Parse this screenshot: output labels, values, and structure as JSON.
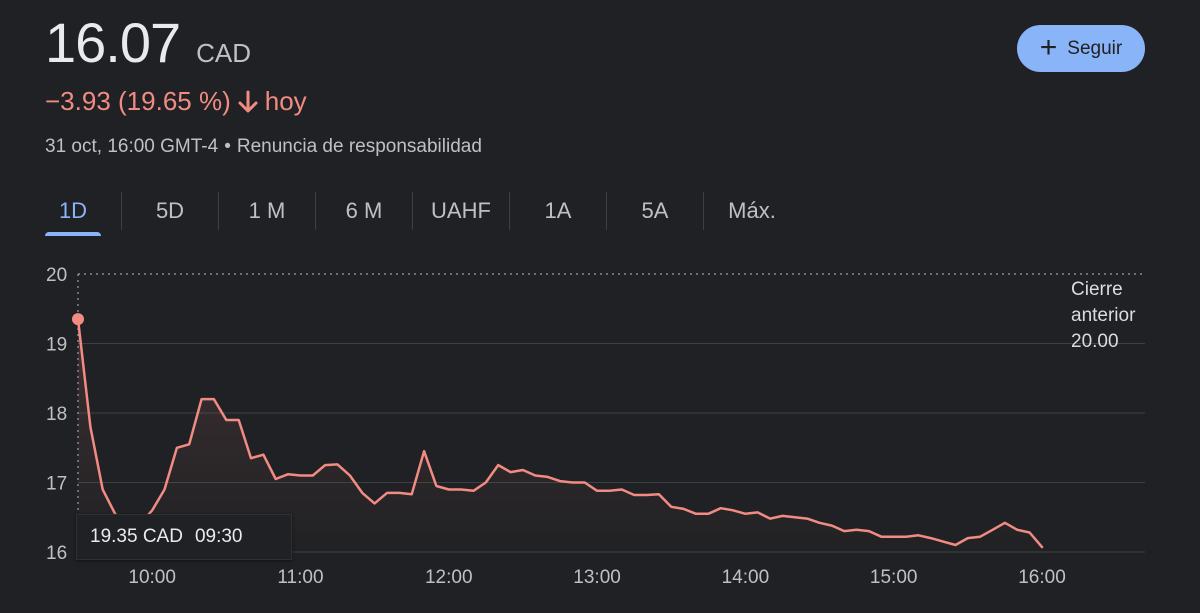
{
  "quote": {
    "price": "16.07",
    "currency": "CAD",
    "change": "−3.93 (19.65 %)",
    "period": "hoy",
    "timestamp": "31 oct, 16:00 GMT-4",
    "separator": "•",
    "disclaimer": "Renuncia de responsabilidad"
  },
  "follow_button": {
    "label": "Seguir",
    "icon": "plus-icon"
  },
  "tabs": [
    {
      "label": "1D",
      "active": true
    },
    {
      "label": "5D",
      "active": false
    },
    {
      "label": "1 M",
      "active": false
    },
    {
      "label": "6 M",
      "active": false
    },
    {
      "label": "UAHF",
      "active": false
    },
    {
      "label": "1A",
      "active": false
    },
    {
      "label": "5A",
      "active": false
    },
    {
      "label": "Máx.",
      "active": false
    }
  ],
  "tooltip": {
    "value": "19.35 CAD",
    "time": "09:30"
  },
  "colors": {
    "line": "#f28b82",
    "accent": "#8ab4f8",
    "background": "#202124",
    "grid": "#3c4043",
    "text": "#bdc1c6"
  },
  "chart_data": {
    "type": "line",
    "y_ticks": [
      "16",
      "17",
      "18",
      "19",
      "20"
    ],
    "x_ticks": [
      "10:00",
      "11:00",
      "12:00",
      "13:00",
      "14:00",
      "15:00",
      "16:00"
    ],
    "ylim": [
      15.9,
      20
    ],
    "xlim": [
      "09:30",
      "16:00"
    ],
    "grid": true,
    "previous_close": {
      "label_lines": [
        "Cierre",
        "anterior"
      ],
      "value": "20.00",
      "y": 20.0
    },
    "series": [
      {
        "x": [
          "09:30",
          "09:35",
          "09:40",
          "09:45",
          "09:50",
          "09:55",
          "10:00",
          "10:05",
          "10:10",
          "10:15",
          "10:20",
          "10:25",
          "10:30",
          "10:35",
          "10:40",
          "10:45",
          "10:50",
          "10:55",
          "11:00",
          "11:05",
          "11:10",
          "11:15",
          "11:20",
          "11:25",
          "11:30",
          "11:35",
          "11:40",
          "11:45",
          "11:50",
          "11:55",
          "12:00",
          "12:05",
          "12:10",
          "12:15",
          "12:20",
          "12:25",
          "12:30",
          "12:35",
          "12:40",
          "12:45",
          "12:50",
          "12:55",
          "13:00",
          "13:05",
          "13:10",
          "13:15",
          "13:20",
          "13:25",
          "13:30",
          "13:35",
          "13:40",
          "13:45",
          "13:50",
          "13:55",
          "14:00",
          "14:05",
          "14:10",
          "14:15",
          "14:20",
          "14:25",
          "14:30",
          "14:35",
          "14:40",
          "14:45",
          "14:50",
          "14:55",
          "15:00",
          "15:05",
          "15:10",
          "15:15",
          "15:20",
          "15:25",
          "15:30",
          "15:35",
          "15:40",
          "15:45",
          "15:50",
          "15:55",
          "16:00"
        ],
        "y": [
          19.35,
          17.8,
          16.9,
          16.55,
          16.35,
          16.4,
          16.6,
          16.9,
          17.5,
          17.55,
          18.2,
          18.2,
          17.9,
          17.9,
          17.35,
          17.4,
          17.05,
          17.12,
          17.1,
          17.1,
          17.25,
          17.26,
          17.1,
          16.85,
          16.7,
          16.85,
          16.85,
          16.83,
          17.45,
          16.95,
          16.9,
          16.9,
          16.88,
          17.0,
          17.25,
          17.15,
          17.18,
          17.1,
          17.08,
          17.02,
          17.0,
          17.0,
          16.88,
          16.88,
          16.9,
          16.82,
          16.82,
          16.83,
          16.65,
          16.62,
          16.55,
          16.55,
          16.63,
          16.6,
          16.55,
          16.57,
          16.48,
          16.52,
          16.5,
          16.48,
          16.42,
          16.38,
          16.3,
          16.32,
          16.3,
          16.22,
          16.22,
          16.22,
          16.24,
          16.2,
          16.15,
          16.1,
          16.2,
          16.22,
          16.32,
          16.42,
          16.32,
          16.28,
          16.07
        ]
      }
    ]
  }
}
